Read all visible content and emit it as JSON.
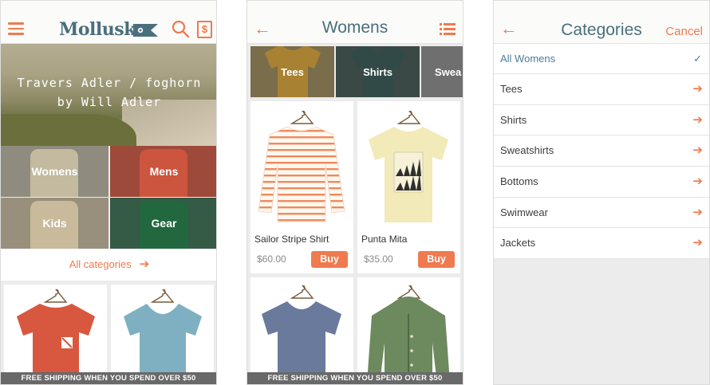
{
  "screens": {
    "home": {
      "logo_text": "Mollusk",
      "hero_line1": "Travers Adler / foghorn",
      "hero_line2": "by Will Adler",
      "categories": [
        {
          "label": "Womens",
          "color": "#cfc6a8"
        },
        {
          "label": "Mens",
          "color": "#d8583f"
        },
        {
          "label": "Kids",
          "color": "#e7d7b0"
        },
        {
          "label": "Gear",
          "color": "#1f6b3d"
        }
      ],
      "all_categories_label": "All categories",
      "banner": "FREE SHIPPING WHEN YOU SPEND OVER $50"
    },
    "list": {
      "title": "Womens",
      "chips": [
        {
          "label": "Tees",
          "color": "#b88a2a"
        },
        {
          "label": "Shirts",
          "color": "#2f4b47"
        },
        {
          "label": "Swea",
          "color": "#7d7d7d"
        }
      ],
      "products": [
        {
          "name": "Sailor Stripe Shirt",
          "price": "$60.00",
          "buy": "Buy"
        },
        {
          "name": "Punta Mita",
          "price": "$35.00",
          "buy": "Buy"
        }
      ],
      "banner": "FREE SHIPPING WHEN YOU SPEND OVER $50"
    },
    "categories": {
      "title": "Categories",
      "cancel": "Cancel",
      "items": [
        {
          "label": "All Womens",
          "selected": true
        },
        {
          "label": "Tees",
          "selected": false
        },
        {
          "label": "Shirts",
          "selected": false
        },
        {
          "label": "Sweatshirts",
          "selected": false
        },
        {
          "label": "Bottoms",
          "selected": false
        },
        {
          "label": "Swimwear",
          "selected": false
        },
        {
          "label": "Jackets",
          "selected": false
        }
      ]
    }
  },
  "colors": {
    "accent": "#ef7a4f",
    "brand": "#4a6f7c"
  },
  "icons": {
    "menu": "hamburger-icon",
    "search": "search-icon",
    "receipt": "receipt-dollar-icon",
    "back": "back-arrow-icon",
    "list": "list-icon",
    "forward": "forward-arrow-icon",
    "check": "checkmark-icon"
  }
}
